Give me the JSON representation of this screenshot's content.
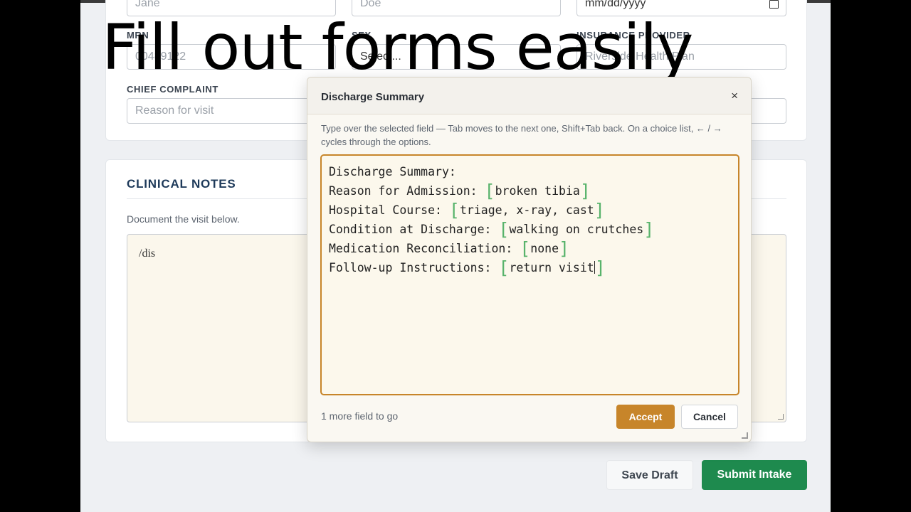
{
  "patient_form": {
    "first_name_value": "Jane",
    "last_name_value": "Doe",
    "dob_placeholder": "mm/dd/yyyy",
    "mrn_label": "MRN",
    "mrn_value": "00489122",
    "sex_label": "SEX",
    "sex_value": "Select...",
    "insurance_label": "INSURANCE PROVIDER",
    "insurance_value": "Riverside Health Plan",
    "chief_complaint_label": "CHIEF COMPLAINT",
    "chief_complaint_placeholder": "Reason for visit"
  },
  "clinical_notes": {
    "title": "CLINICAL NOTES",
    "help": "Document the visit below.",
    "text": "/dis"
  },
  "footer": {
    "save_draft": "Save Draft",
    "submit_intake": "Submit Intake"
  },
  "overlay_caption": "Fill out forms easily",
  "dialog": {
    "title": "Discharge Summary",
    "close": "×",
    "instructions": "Type over the selected field — Tab moves to the next one, Shift+Tab back. On a choice list, ← / → cycles through the options.",
    "editor": {
      "heading": "Discharge Summary:",
      "fields": [
        {
          "label": "Reason for Admission: ",
          "value": "broken tibia"
        },
        {
          "label": "Hospital Course: ",
          "value": "triage, x-ray, cast"
        },
        {
          "label": "Condition at Discharge: ",
          "value": "walking on crutches"
        },
        {
          "label": "Medication Reconciliation: ",
          "value": "none"
        },
        {
          "label": "Follow-up Instructions: ",
          "value": "return visit"
        }
      ]
    },
    "status": "1 more field to go",
    "accept": "Accept",
    "cancel": "Cancel"
  },
  "colors": {
    "accent": "#c7852a",
    "primary": "#1e8a4e",
    "slot_bracket": "#58b36b",
    "heading": "#1e3a5a"
  }
}
